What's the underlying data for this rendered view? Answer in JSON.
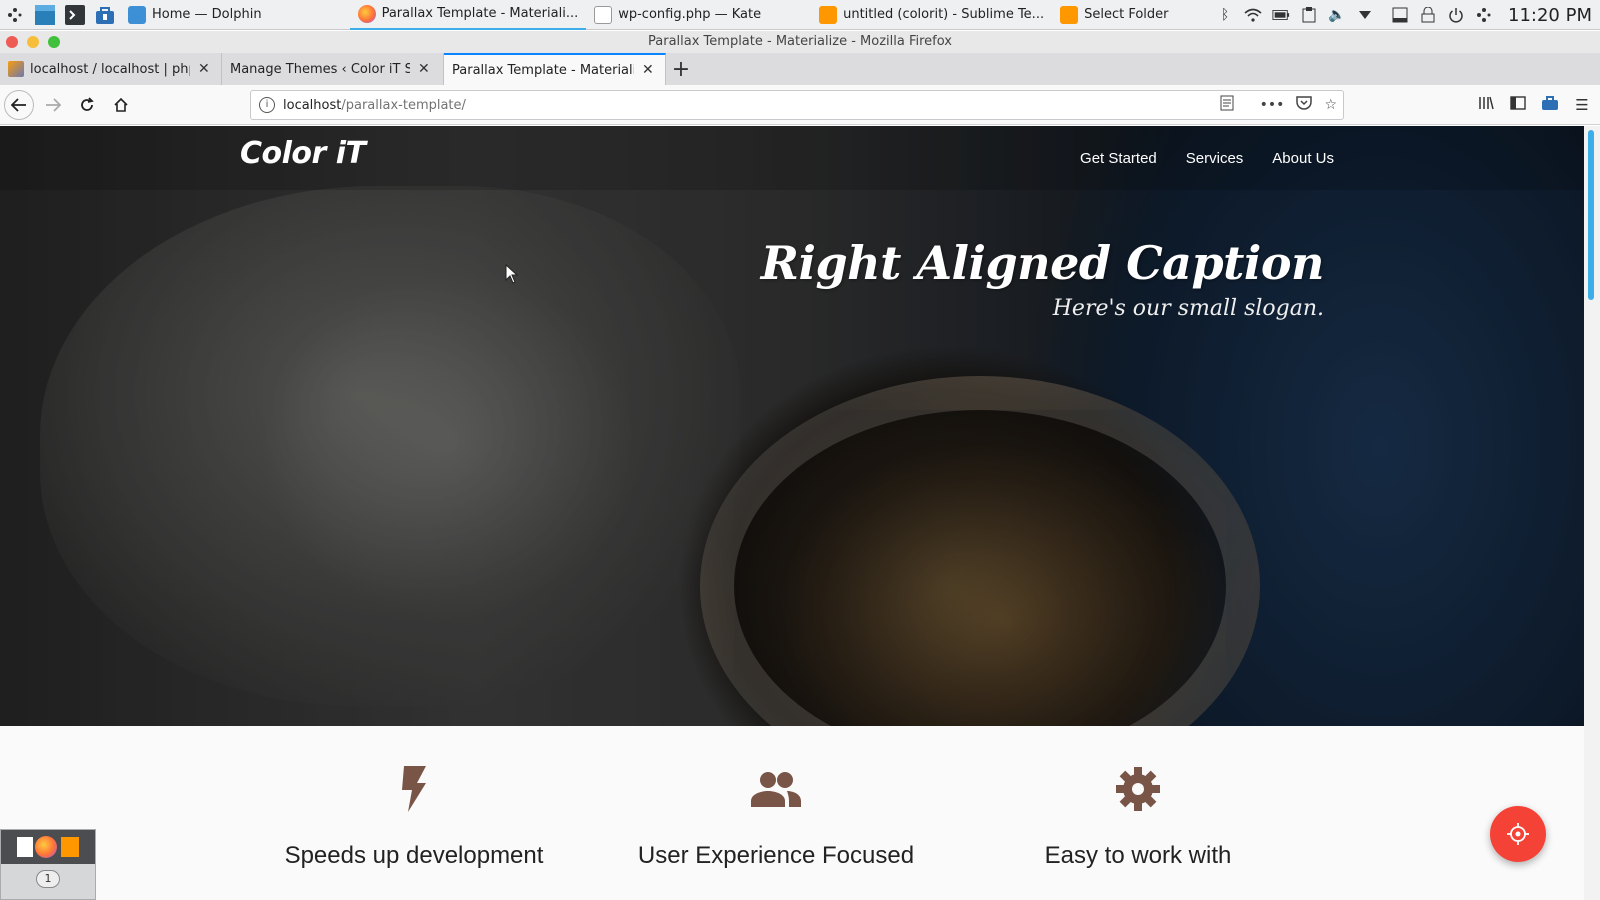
{
  "taskbar": {
    "tasks": [
      {
        "label": "Home — Dolphin",
        "icon": "folder-icon"
      },
      {
        "label": "Parallax Template - Materiali...",
        "icon": "firefox-icon"
      },
      {
        "label": "wp-config.php  — Kate",
        "icon": "text-file-icon"
      },
      {
        "label": "untitled (colorit) - Sublime Te...",
        "icon": "sublime-icon"
      },
      {
        "label": "Select Folder",
        "icon": "sublime-icon"
      }
    ],
    "clock": "11:20 PM"
  },
  "window": {
    "title": "Parallax Template - Materialize - Mozilla Firefox"
  },
  "tabs": [
    {
      "label": "localhost / localhost | phpM"
    },
    {
      "label": "Manage Themes ‹ Color iT Solu"
    },
    {
      "label": "Parallax Template - Materialize"
    }
  ],
  "urlbar": {
    "host": "localhost",
    "path": "/parallax-template/"
  },
  "site": {
    "brand": "Color iT",
    "menu": [
      "Get Started",
      "Services",
      "About Us"
    ],
    "caption_title": "Right Aligned Caption",
    "caption_slogan": "Here's our small slogan."
  },
  "features": [
    {
      "title": "Speeds up development",
      "icon": "flash-icon"
    },
    {
      "title": "User Experience Focused",
      "icon": "group-icon"
    },
    {
      "title": "Easy to work with",
      "icon": "settings-icon"
    }
  ],
  "pager": {
    "desktop": "1"
  },
  "colors": {
    "accent": "#3daee9",
    "icon_brown": "#795548",
    "fab_red": "#f44336"
  }
}
